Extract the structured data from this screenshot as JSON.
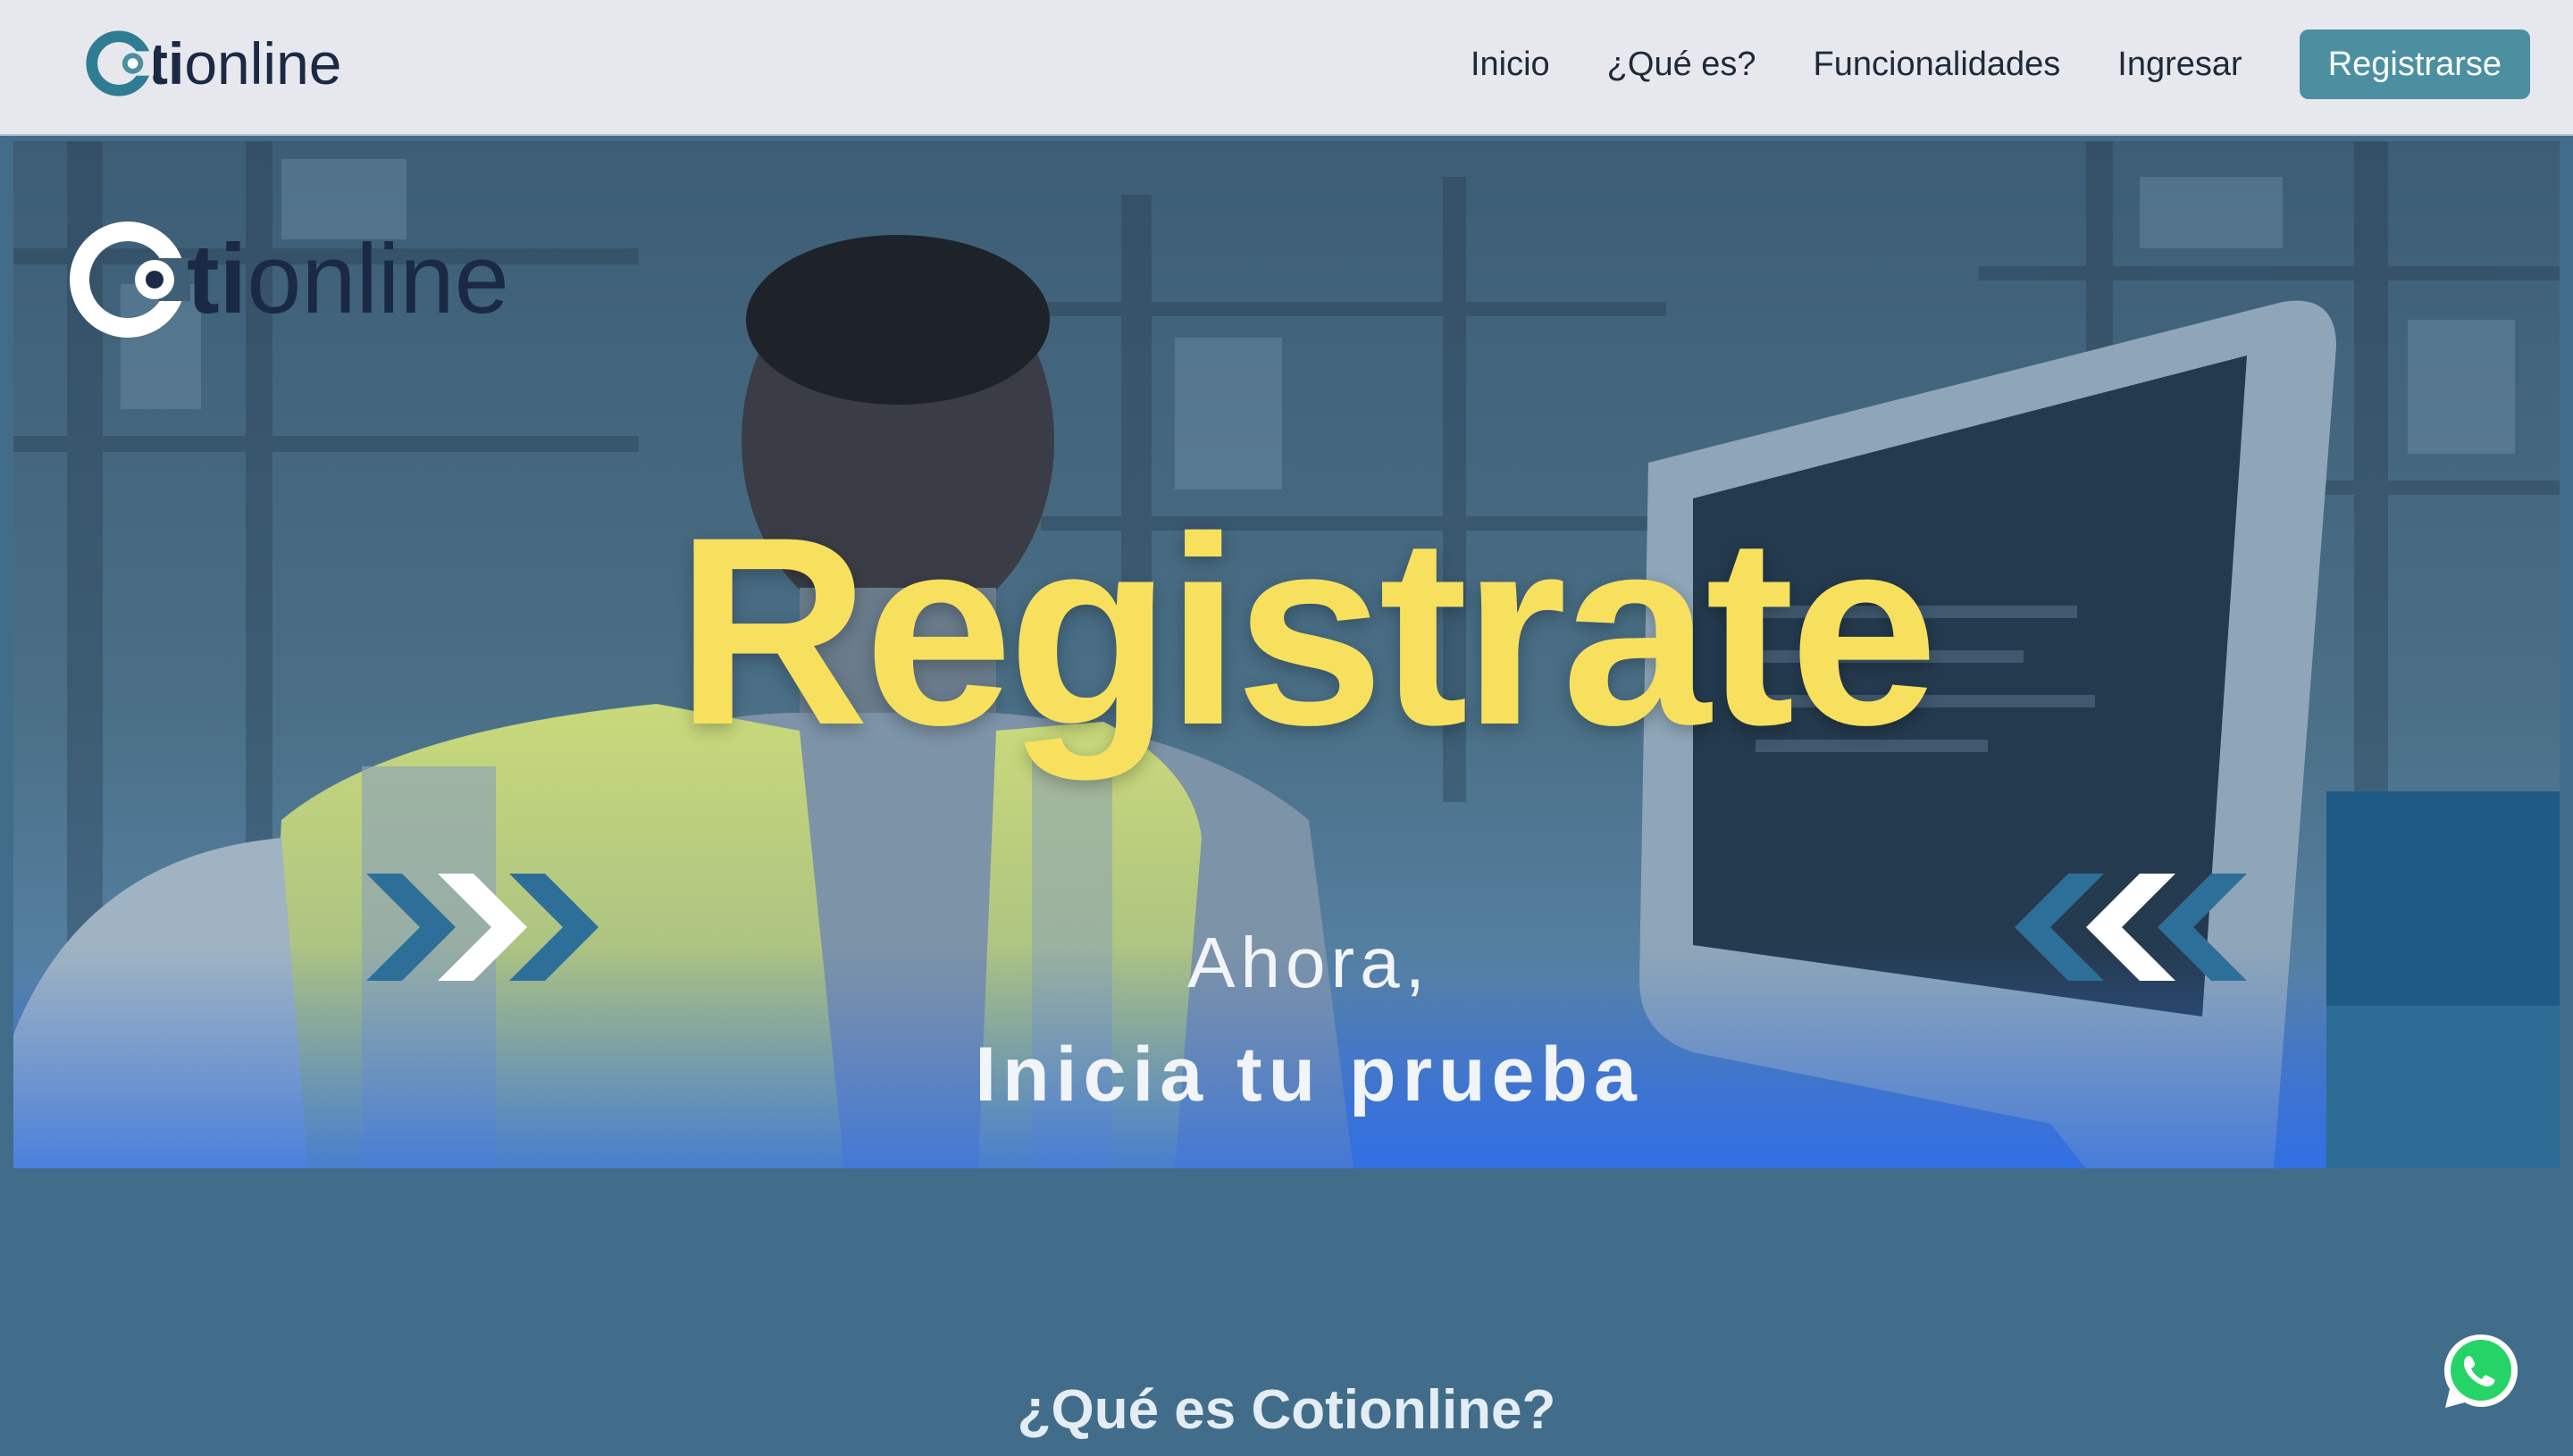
{
  "brand": {
    "name_prefix": "o",
    "name_bold": "ti",
    "name_rest": "online"
  },
  "nav": {
    "items": [
      {
        "label": "Inicio"
      },
      {
        "label": "¿Qué es?"
      },
      {
        "label": "Funcionalidades"
      },
      {
        "label": "Ingresar"
      }
    ],
    "cta_label": "Registrarse"
  },
  "hero": {
    "headline": "Registrate",
    "subtitle_1": "Ahora,",
    "subtitle_2": "Inicia tu prueba"
  },
  "section": {
    "title": "¿Qué es Cotionline?"
  },
  "icons": {
    "brand_logo": "cotionline-logo-icon",
    "whatsapp": "whatsapp-icon",
    "chevrons_right": "double-chevron-right-icon",
    "chevrons_left": "double-chevron-left-icon"
  },
  "colors": {
    "nav_bg": "#e7e8ed",
    "brand_teal": "#4c8fa0",
    "brand_dark": "#1b2a44",
    "headline_yellow": "#f6e05e",
    "section_bg": "#426d8a",
    "whatsapp_green": "#25d366"
  }
}
